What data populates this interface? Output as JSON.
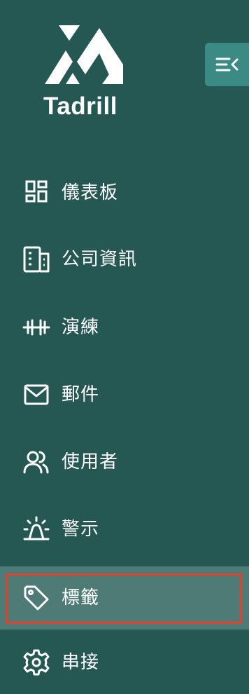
{
  "brand": {
    "name": "Tadrill",
    "logo_icon": "tadrill-logo"
  },
  "toggle": {
    "icon": "collapse-menu-icon"
  },
  "nav": {
    "items": [
      {
        "label": "儀表板",
        "icon": "dashboard-icon"
      },
      {
        "label": "公司資訊",
        "icon": "building-icon"
      },
      {
        "label": "演練",
        "icon": "dumbbell-icon"
      },
      {
        "label": "郵件",
        "icon": "mail-icon"
      },
      {
        "label": "使用者",
        "icon": "users-icon"
      },
      {
        "label": "警示",
        "icon": "alarm-icon"
      },
      {
        "label": "標籤",
        "icon": "tag-icon",
        "active": true
      },
      {
        "label": "串接",
        "icon": "gear-icon"
      }
    ]
  },
  "colors": {
    "sidebar_bg": "#255753",
    "active_bg": "#4f7b77",
    "toggle_bg": "#3b8a83",
    "highlight_border": "#e2412e",
    "text": "#ffffff"
  }
}
